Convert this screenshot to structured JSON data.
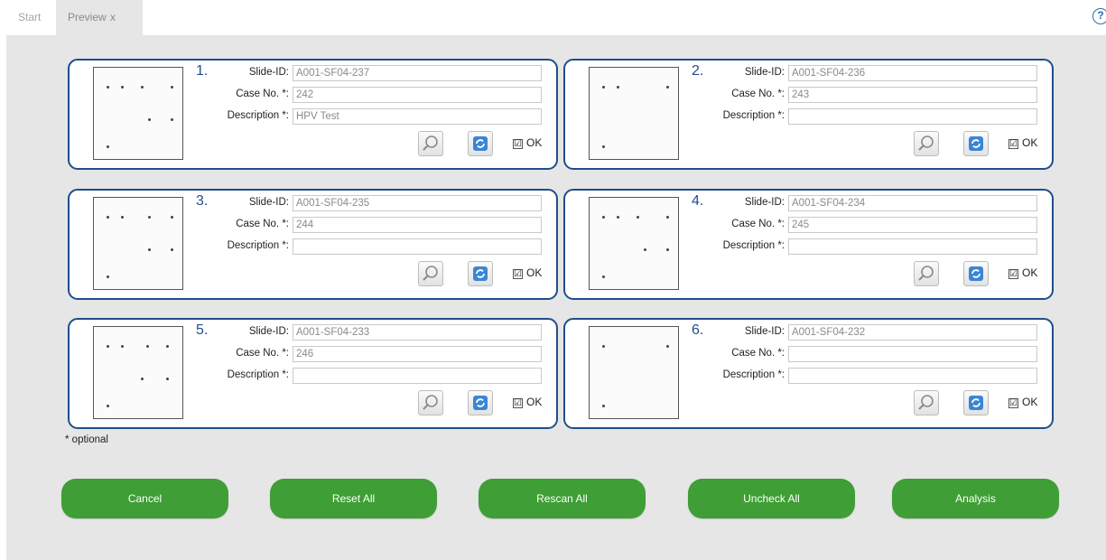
{
  "tabs": {
    "start": "Start",
    "preview": "Preview",
    "close": "x"
  },
  "help": "?",
  "labels": {
    "slide_id": "Slide-ID:",
    "case_no": "Case No. *:",
    "description": "Description *:",
    "ok": "OK",
    "ok_mark": "☑"
  },
  "cards": [
    {
      "number": "1.",
      "slide_id": "A001-SF04-237",
      "case_no": "242",
      "description": "HPV Test",
      "ok_checked": true
    },
    {
      "number": "2.",
      "slide_id": "A001-SF04-236",
      "case_no": "243",
      "description": "",
      "ok_checked": true
    },
    {
      "number": "3.",
      "slide_id": "A001-SF04-235",
      "case_no": "244",
      "description": "",
      "ok_checked": true
    },
    {
      "number": "4.",
      "slide_id": "A001-SF04-234",
      "case_no": "245",
      "description": "",
      "ok_checked": true
    },
    {
      "number": "5.",
      "slide_id": "A001-SF04-233",
      "case_no": "246",
      "description": "",
      "ok_checked": true
    },
    {
      "number": "6.",
      "slide_id": "A001-SF04-232",
      "case_no": "",
      "description": "",
      "ok_checked": true
    }
  ],
  "optional_note": "* optional",
  "buttons": {
    "cancel": "Cancel",
    "reset_all": "Reset All",
    "rescan_all": "Rescan All",
    "uncheck_all": "Uncheck All",
    "analysis": "Analysis"
  },
  "colors": {
    "card_border": "#1f4e8c",
    "action_green": "#3f9e35",
    "background": "#e6e6e6"
  }
}
